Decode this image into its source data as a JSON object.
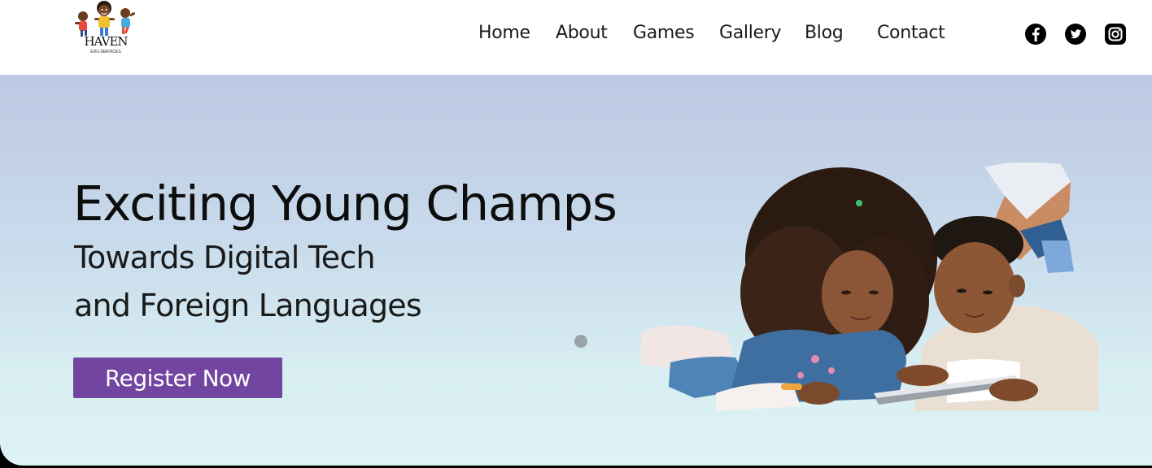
{
  "header": {
    "logo": {
      "text": "HAVEN",
      "subtext": "EDU-SERVICES"
    },
    "nav": [
      {
        "label": "Home"
      },
      {
        "label": "About"
      },
      {
        "label": "Games"
      },
      {
        "label": "Gallery"
      },
      {
        "label": "Blog"
      },
      {
        "label": "Contact"
      }
    ],
    "social": [
      {
        "icon": "facebook-icon"
      },
      {
        "icon": "twitter-icon"
      },
      {
        "icon": "instagram-icon"
      }
    ]
  },
  "hero": {
    "title": "Exciting Young Champs",
    "subtitle_line1": "Towards Digital Tech",
    "subtitle_line2": "and Foreign Languages",
    "cta_label": "Register Now",
    "slider": {
      "active_slide": 1
    },
    "image_description_icon": "children-with-tablet-image"
  },
  "colors": {
    "accent": "#7245a0",
    "hero_top": "#bec8e3",
    "hero_bottom": "#def3f4",
    "text": "#0d0d0d"
  }
}
